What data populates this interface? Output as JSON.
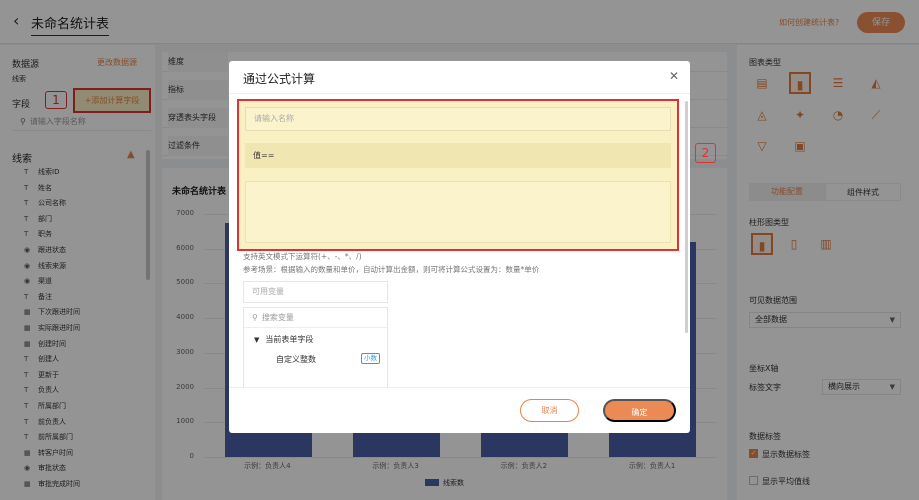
{
  "header": {
    "back_icon": "back-arrow-icon",
    "title": "未命名统计表",
    "help_link": "如何创建统计表?",
    "save_label": "保存"
  },
  "left_panel": {
    "datasource_label": "数据源",
    "change_datasource": "更改数据源",
    "datasource_value": "线索",
    "field_label": "字段",
    "annotation_1": "1",
    "add_calc_field": "+添加计算字段",
    "field_search_placeholder": "请输入字段名称",
    "section_title": "线索",
    "fields": [
      {
        "icon": "T",
        "label": "线索ID"
      },
      {
        "icon": "T",
        "label": "姓名"
      },
      {
        "icon": "T",
        "label": "公司名称"
      },
      {
        "icon": "T",
        "label": "部门"
      },
      {
        "icon": "T",
        "label": "职务"
      },
      {
        "icon": "◉",
        "label": "跟进状态"
      },
      {
        "icon": "◉",
        "label": "线索来源"
      },
      {
        "icon": "◉",
        "label": "渠道"
      },
      {
        "icon": "T",
        "label": "备注"
      },
      {
        "icon": "▦",
        "label": "下次跟进时间"
      },
      {
        "icon": "▦",
        "label": "实际跟进时间"
      },
      {
        "icon": "▦",
        "label": "创建时间"
      },
      {
        "icon": "T",
        "label": "创建人"
      },
      {
        "icon": "T",
        "label": "更新于"
      },
      {
        "icon": "T",
        "label": "负责人"
      },
      {
        "icon": "T",
        "label": "所属部门"
      },
      {
        "icon": "T",
        "label": "前负责人"
      },
      {
        "icon": "T",
        "label": "前所属部门"
      },
      {
        "icon": "▦",
        "label": "转客户时间"
      },
      {
        "icon": "◉",
        "label": "审批状态"
      },
      {
        "icon": "▦",
        "label": "审批完成时间"
      }
    ]
  },
  "config_rows": {
    "dimension": "维度",
    "metric": "指标",
    "pivot": "穿透表头字段",
    "filter": "过滤条件"
  },
  "chart_data": {
    "type": "bar",
    "title": "未命名统计表",
    "categories": [
      "示例：负责人4",
      "示例：负责人3",
      "示例：负责人2",
      "示例：负责人1"
    ],
    "series": [
      {
        "name": "线索数",
        "values": [
          6750,
          5000,
          5000,
          6200
        ]
      }
    ],
    "y_ticks": [
      "7000",
      "6000",
      "5000",
      "4000",
      "3000",
      "2000",
      "1000",
      "0"
    ],
    "ylim": [
      0,
      7000
    ],
    "legend_position": "bottom"
  },
  "right_panel": {
    "chart_type_title": "图表类型",
    "chart_types": [
      {
        "icon": "table-icon",
        "glyph": "▤"
      },
      {
        "icon": "bar-chart-icon",
        "glyph": "▮"
      },
      {
        "icon": "horizontal-bar-icon",
        "glyph": "☰"
      },
      {
        "icon": "area-chart-icon",
        "glyph": "◭"
      },
      {
        "icon": "stacked-area-icon",
        "glyph": "◬"
      },
      {
        "icon": "rose-chart-icon",
        "glyph": "✦"
      },
      {
        "icon": "pie-chart-icon",
        "glyph": "◔"
      },
      {
        "icon": "line-chart-icon",
        "glyph": "⟋"
      },
      {
        "icon": "funnel-icon",
        "glyph": "▽"
      },
      {
        "icon": "card-icon",
        "glyph": "▣"
      }
    ],
    "tab_config": "功能配置",
    "tab_style": "组件样式",
    "bar_type_title": "柱形图类型",
    "bar_types": [
      {
        "icon": "basic-bar-icon",
        "glyph": "▮"
      },
      {
        "icon": "grouped-bar-icon",
        "glyph": "▯"
      },
      {
        "icon": "stacked-bar-icon",
        "glyph": "▥"
      }
    ],
    "data_range_title": "可见数据范围",
    "data_range_value": "全部数据",
    "x_axis_title": "坐标X轴",
    "label_text": "标签文字",
    "label_value": "横向展示",
    "data_label_title": "数据标签",
    "show_data_label": "显示数据标签",
    "show_avg_line": "显示平均值线"
  },
  "modal": {
    "title": "通过公式计算",
    "name_placeholder": "请输入名称",
    "formula_prefix": "值==",
    "annotation_2": "2",
    "help_line_1": "支持英文模式下运算符(+、-、*、/)",
    "help_line_2": "参考场景：根据输入的数量和单价，自动计算出金额，则可将计算公式设置为：数量*单价",
    "variable_placeholder": "可用变量",
    "variable_search_placeholder": "搜索变量",
    "variable_group": "当前表单字段",
    "variable_item": "自定义整数",
    "variable_tag": "小数",
    "cancel_label": "取消",
    "confirm_label": "确定"
  }
}
